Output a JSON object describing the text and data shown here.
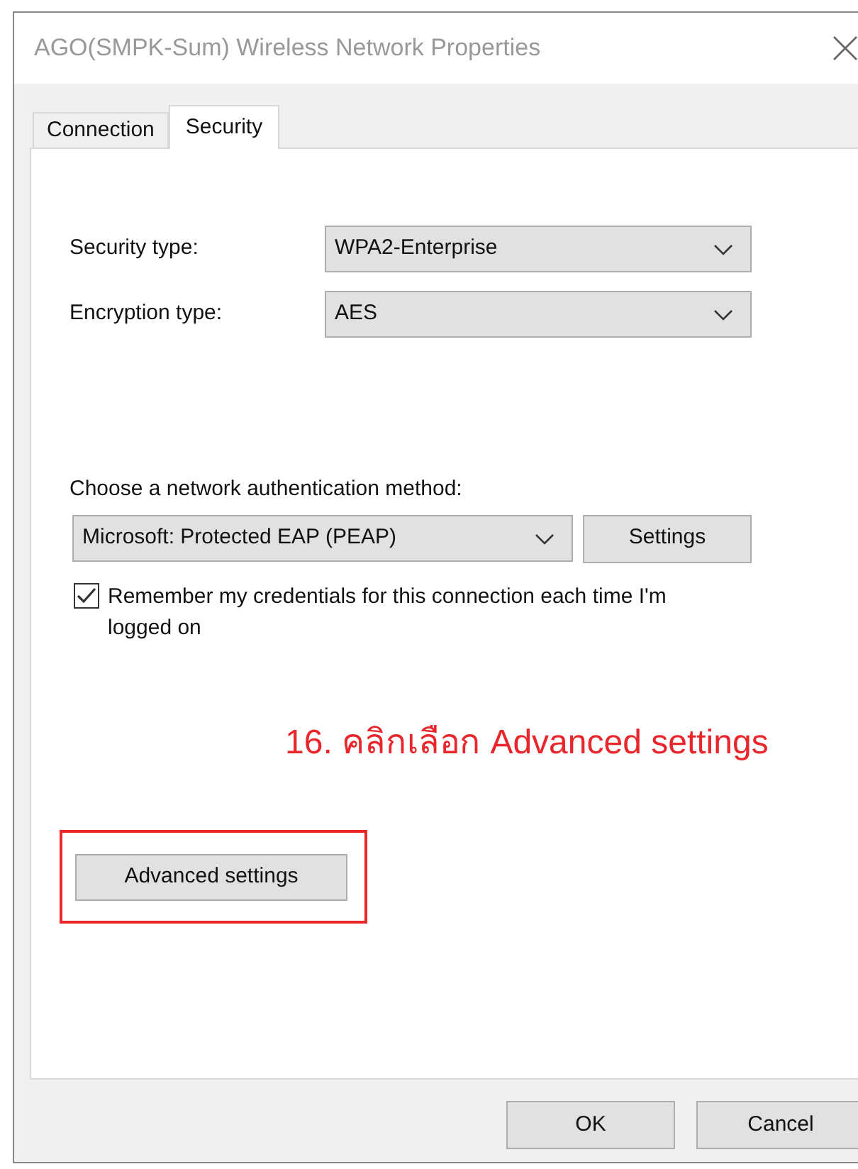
{
  "window": {
    "title": "AGO(SMPK-Sum) Wireless Network Properties"
  },
  "tabs": [
    {
      "label": "Connection",
      "selected": false
    },
    {
      "label": "Security",
      "selected": true
    }
  ],
  "fields": [
    {
      "label": "Security type:",
      "value": "WPA2-Enterprise"
    },
    {
      "label": "Encryption type:",
      "value": "AES"
    }
  ],
  "authentication": {
    "label": "Choose a network authentication method:",
    "value": "Microsoft: Protected EAP (PEAP)",
    "button": "Settings"
  },
  "remember_credentials": {
    "label": "Remember my credentials for this connection each time I'm logged on",
    "checked": true
  },
  "annotation": "16. คลิกเลือก Advanced settings",
  "advanced_button": {
    "label": "Advanced settings",
    "highlighted": true
  },
  "buttons": [
    "OK",
    "Cancel"
  ]
}
